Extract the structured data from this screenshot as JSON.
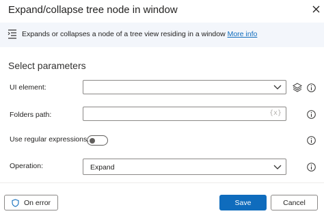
{
  "dialog": {
    "title": "Expand/collapse tree node in window",
    "close_icon": "close-icon"
  },
  "banner": {
    "icon": "description-icon",
    "text": "Expands or collapses a node of a tree view residing in a window",
    "link": "More info"
  },
  "parameters": {
    "section_title": "Select parameters",
    "ui_element": {
      "label": "UI element:",
      "value": ""
    },
    "folders_path": {
      "label": "Folders path:",
      "value": "",
      "variable_icon": "{x}"
    },
    "use_regex": {
      "label": "Use regular expressions:",
      "enabled": false
    },
    "operation": {
      "label": "Operation:",
      "value": "Expand"
    }
  },
  "footer": {
    "on_error": "On error",
    "save": "Save",
    "cancel": "Cancel"
  },
  "colors": {
    "accent": "#0f6cbd",
    "banner_bg": "#f3f6fb"
  }
}
